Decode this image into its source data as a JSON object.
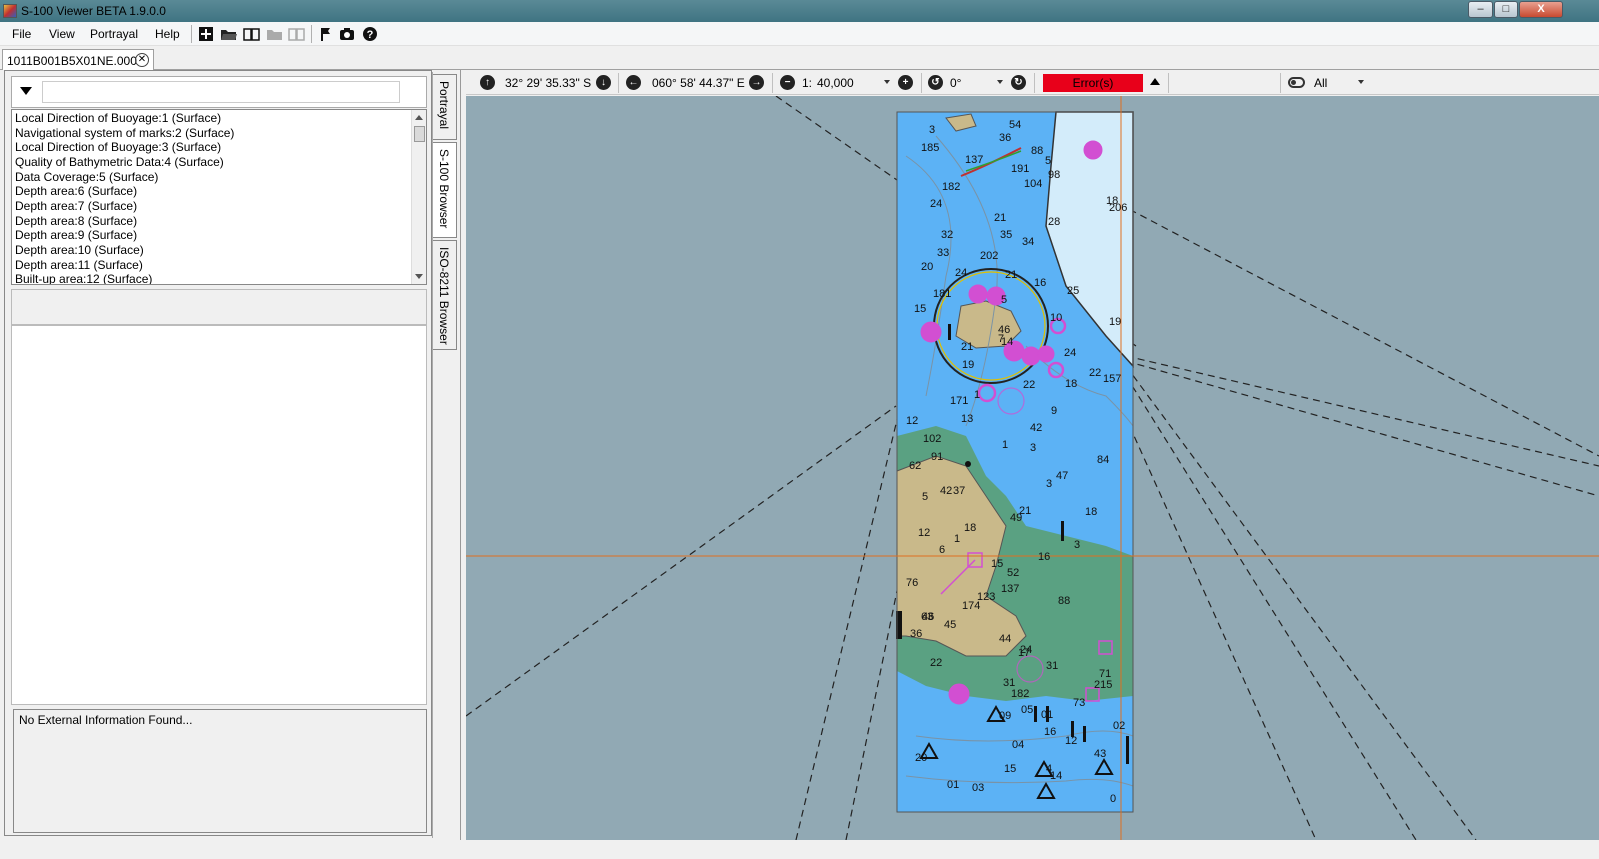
{
  "window": {
    "title": "S-100 Viewer BETA 1.9.0.0",
    "minimize": "–",
    "maximize": "□",
    "close": "X"
  },
  "menu": {
    "file": "File",
    "view": "View",
    "portrayal": "Portrayal",
    "help": "Help"
  },
  "toolbar_icons": [
    "add-icon",
    "open-folder-icon",
    "book-icon",
    "folder-disabled-icon",
    "book-disabled-icon",
    "flag-icon",
    "camera-icon",
    "help-icon"
  ],
  "document_tab": {
    "label": "1011B001B5X01NE.000",
    "close": "✕"
  },
  "feature_list": {
    "items": [
      "Local Direction of Buoyage:1 (Surface)",
      "Navigational system of marks:2 (Surface)",
      "Local Direction of Buoyage:3 (Surface)",
      "Quality of Bathymetric Data:4 (Surface)",
      "Data Coverage:5 (Surface)",
      "Depth area:6 (Surface)",
      "Depth area:7 (Surface)",
      "Depth area:8 (Surface)",
      "Depth area:9 (Surface)",
      "Depth area:10 (Surface)",
      "Depth area:11 (Surface)",
      "Built-up area:12 (Surface)"
    ]
  },
  "external_info": "No External Information Found...",
  "side_tabs": [
    "Portrayal",
    "S-100 Browser",
    "ISO-8211 Browser"
  ],
  "map_toolbar": {
    "latitude": "32° 29' 35.33\" S",
    "longitude": "060° 58' 44.37\" E",
    "scale_prefix": "1:",
    "scale": "40,000",
    "rotation": "0°",
    "error": "Error(s)",
    "filter": "All"
  },
  "colors": {
    "map_background": "#91a9b4",
    "deep_water": "#5cb2f5",
    "shallow_water": "#d3ecfa",
    "land": "#c9b98a",
    "intertidal": "#5aa182",
    "magenta": "#d24fd2",
    "error_red": "#e8001a"
  },
  "chart_soundings": [
    "54",
    "3",
    "36",
    "185",
    "88",
    "137",
    "5",
    "191",
    "98",
    "104",
    "182",
    "18",
    "24",
    "206",
    "21",
    "28",
    "32",
    "35",
    "34",
    "33",
    "202",
    "20",
    "24",
    "21",
    "16",
    "25",
    "181",
    "5",
    "15",
    "10",
    "19",
    "46",
    "7",
    "14",
    "21",
    "24",
    "19",
    "22",
    "157",
    "18",
    "22",
    "1",
    "171",
    "9",
    "13",
    "12",
    "42",
    "102",
    "1",
    "3",
    "91",
    "84",
    "62",
    "47",
    "3",
    "37",
    "42",
    "5",
    "21",
    "18",
    "49",
    "18",
    "12",
    "1",
    "3",
    "6",
    "16",
    "15",
    "52",
    "76",
    "137",
    "123",
    "88",
    "174",
    "63",
    "46",
    "45",
    "36",
    "44",
    "24",
    "17",
    "22",
    "31",
    "71",
    "31",
    "215",
    "182",
    "73",
    "05",
    "01",
    "09",
    "02",
    "16",
    "12",
    "04",
    "43",
    "20",
    "15",
    "4",
    "14",
    "01",
    "03",
    "0"
  ]
}
